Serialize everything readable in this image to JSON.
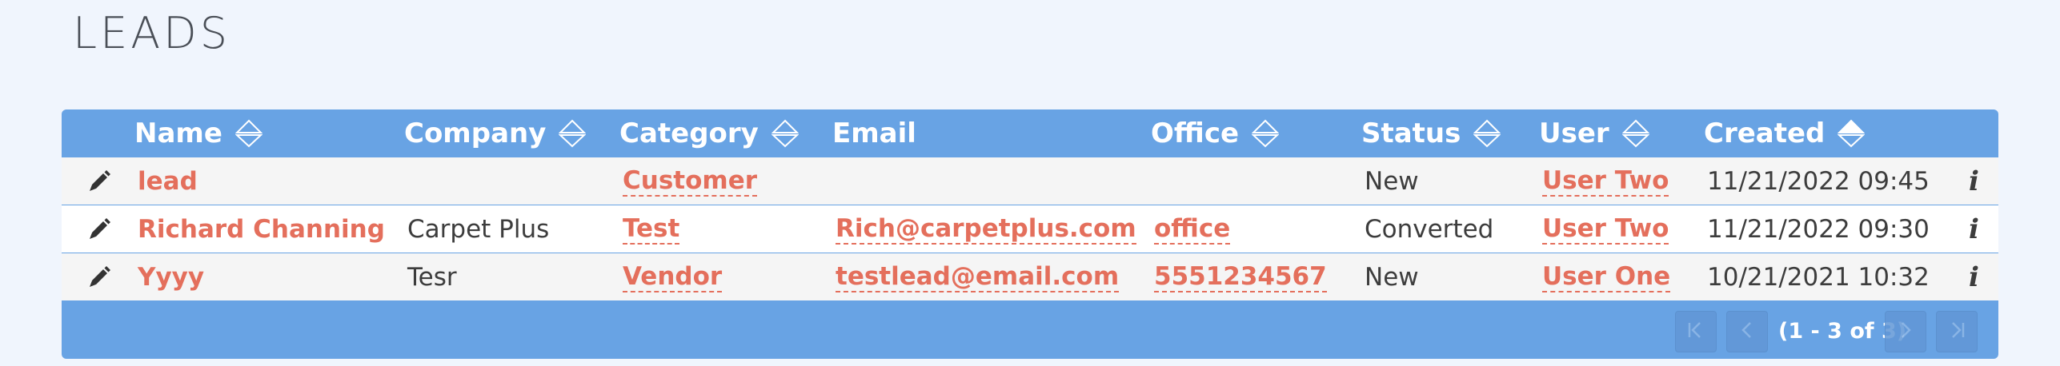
{
  "page": {
    "title": "LEADS"
  },
  "colors": {
    "header_bg": "#68a3e4",
    "link": "#e46f5c",
    "row_alt": "#f5f5f5",
    "page_bg": "#f0f5fd"
  },
  "table": {
    "columns": [
      {
        "label": "Name",
        "sort": "none"
      },
      {
        "label": "Company",
        "sort": "none"
      },
      {
        "label": "Category",
        "sort": "none"
      },
      {
        "label": "Email",
        "sort": "none"
      },
      {
        "label": "Office",
        "sort": "none"
      },
      {
        "label": "Status",
        "sort": "none"
      },
      {
        "label": "User",
        "sort": "none"
      },
      {
        "label": "Created",
        "sort": "ascending"
      }
    ],
    "rows": [
      {
        "name": "lead",
        "company": "",
        "category": "Customer",
        "email": "",
        "office": "",
        "status": "New",
        "user": "User Two",
        "created": "11/21/2022 09:45",
        "info": "i"
      },
      {
        "name": "Richard Channing",
        "company": "Carpet Plus",
        "category": "Test",
        "email": "Rich@carpetplus.com",
        "office": "office",
        "status": "Converted",
        "user": "User Two",
        "created": "11/21/2022 09:30",
        "info": "i"
      },
      {
        "name": "Yyyy",
        "company": "Tesr",
        "category": "Vendor",
        "email": "testlead@email.com",
        "office": "5551234567",
        "status": "New",
        "user": "User One",
        "created": "10/21/2021 10:32",
        "info": "i"
      }
    ]
  },
  "pagination": {
    "label": "(1 - 3 of 3)",
    "first_icon": "first-page-icon",
    "prev_icon": "prev-page-icon",
    "next_icon": "next-page-icon",
    "last_icon": "last-page-icon"
  }
}
